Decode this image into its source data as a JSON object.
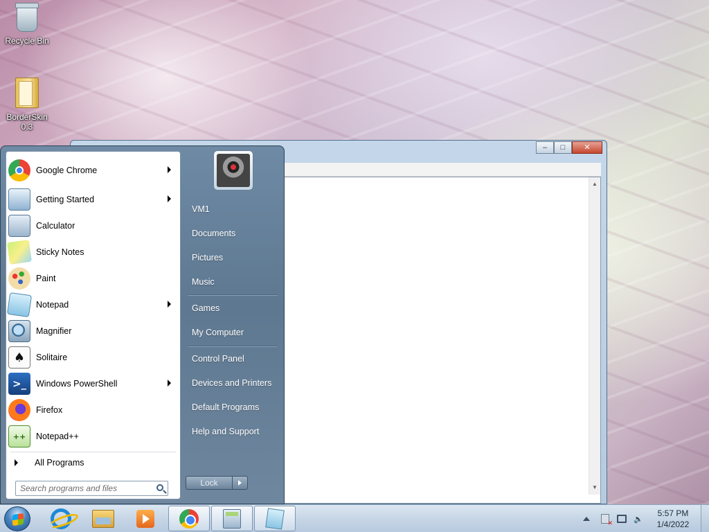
{
  "desktop": {
    "icons": [
      {
        "label": "Recycle Bin",
        "icon": "recycle-bin-icon"
      },
      {
        "label": "BorderSkin\n0.3",
        "icon": "folder-icon"
      }
    ]
  },
  "start_menu": {
    "programs": [
      {
        "label": "Google Chrome",
        "icon": "chrome-icon",
        "submenu": true
      },
      {
        "label": "Getting Started",
        "icon": "getting-started-icon",
        "submenu": true
      },
      {
        "label": "Calculator",
        "icon": "calculator-icon",
        "submenu": false
      },
      {
        "label": "Sticky Notes",
        "icon": "sticky-notes-icon",
        "submenu": false
      },
      {
        "label": "Paint",
        "icon": "paint-icon",
        "submenu": false
      },
      {
        "label": "Notepad",
        "icon": "notepad-icon",
        "submenu": true
      },
      {
        "label": "Magnifier",
        "icon": "magnifier-icon",
        "submenu": false
      },
      {
        "label": "Solitaire",
        "icon": "solitaire-icon",
        "submenu": false
      },
      {
        "label": "Windows PowerShell",
        "icon": "powershell-icon",
        "submenu": true
      },
      {
        "label": "Firefox",
        "icon": "firefox-icon",
        "submenu": false
      },
      {
        "label": "Notepad++",
        "icon": "notepadpp-icon",
        "submenu": false
      }
    ],
    "all_programs": "All Programs",
    "search_placeholder": "Search programs and files",
    "right_links": [
      "VM1",
      "Documents",
      "Pictures",
      "Music",
      "Games",
      "My Computer",
      "Control Panel",
      "Devices and Printers",
      "Default Programs",
      "Help and Support"
    ],
    "lock_label": "Lock"
  },
  "taskbar": {
    "pinned": [
      "internet-explorer-icon",
      "windows-explorer-icon",
      "media-player-icon",
      "chrome-icon",
      "calculator-icon",
      "notepad-icon"
    ],
    "clock_time": "5:57 PM",
    "clock_date": "1/4/2022"
  },
  "colors": {
    "start_menu_bg": "#6f8aa5",
    "taskbar_bg": "#c7d6e6",
    "close_button": "#c7472f"
  }
}
